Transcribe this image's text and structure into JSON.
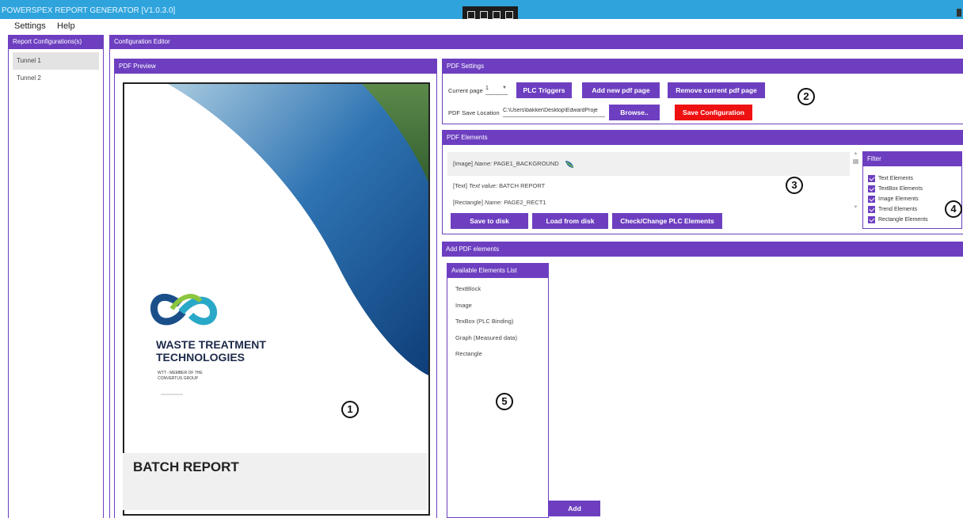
{
  "window": {
    "title": "POWERSPEX REPORT GENERATOR [V1.0.3.0]"
  },
  "menu": [
    "Settings",
    "Help"
  ],
  "sidebar": {
    "header": "Report Configurations(s)",
    "items": [
      "Tunnel 1",
      "Tunnel 2"
    ],
    "selected": "Tunnel 1"
  },
  "editor": {
    "header": "Configuration Editor"
  },
  "preview": {
    "header": "PDF Preview",
    "company_line1": "WASTE TREATMENT",
    "company_line2": "TECHNOLOGIES",
    "tagline_line1": "WTT - MEMBER OF THE",
    "tagline_line2": "CONVERTUS GROUP",
    "report_title": "BATCH REPORT"
  },
  "settings": {
    "header": "PDF Settings",
    "current_page_label": "Current page",
    "current_page_value": "1",
    "plc_triggers": "PLC Triggers",
    "add_page": "Add new pdf page",
    "remove_page": "Remove current pdf page",
    "save_location_label": "PDF Save Location",
    "save_location_value": "C:\\Users\\bakker\\Desktop\\EdwardProje",
    "browse": "Browse..",
    "save_config": "Save Configuration"
  },
  "elements": {
    "header": "PDF Elements",
    "rows": [
      {
        "type": "[Image]",
        "key": "Name:",
        "value": "PAGE1_BACKGROUND"
      },
      {
        "type": "[Text]",
        "key": "Text value:",
        "value": "BATCH REPORT"
      },
      {
        "type": "[Rectangle]",
        "key": "Name:",
        "value": "PAGE2_RECT1"
      }
    ],
    "save": "Save to disk",
    "load": "Load from disk",
    "check": "Check/Change PLC Elements"
  },
  "filter": {
    "header": "Filter",
    "options": [
      "Text Elements",
      "TextBox Elements",
      "Image Elements",
      "Trend Elements",
      "Rectangle Elements"
    ],
    "checked": [
      true,
      true,
      true,
      true,
      true
    ]
  },
  "add_elements": {
    "header": "Add PDF elements",
    "list_header": "Available Elements List",
    "items": [
      "TextBlock",
      "Image",
      "TexBox (PLC Binding)",
      "Graph (Measured data)",
      "Rectangle"
    ],
    "add": "Add"
  },
  "markers": [
    "1",
    "2",
    "3",
    "4",
    "5"
  ],
  "colors": {
    "accent": "#6d3fc0",
    "danger": "#ee1111",
    "titlebar": "#2fa4dc"
  },
  "icons": [
    "window-restore-icon",
    "screen-icon",
    "capture-icon",
    "minimize-icon",
    "dropdown-arrow-icon",
    "checkbox-icon",
    "scroll-up-icon",
    "scroll-down-icon",
    "leaf-icon",
    "logo-icon"
  ]
}
